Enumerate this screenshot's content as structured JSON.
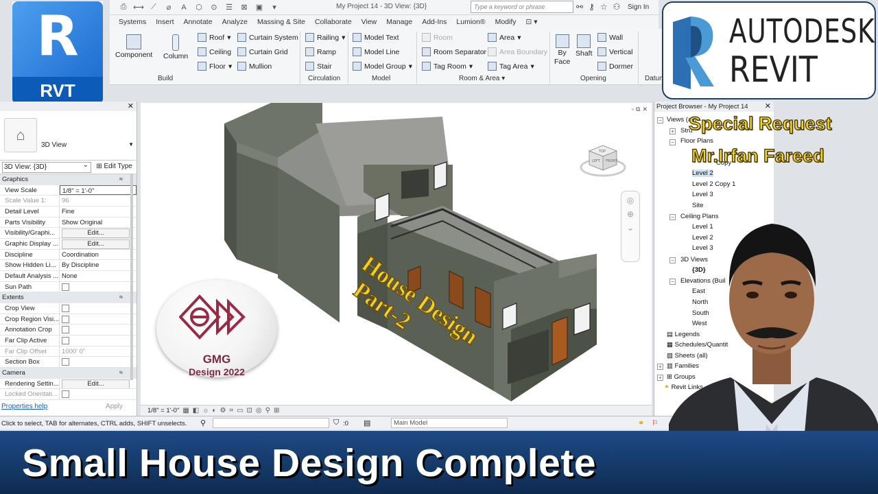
{
  "window": {
    "title": "My Project 14 - 3D View: {3D}",
    "search_placeholder": "Type a keyword or phrase",
    "sign_in": "Sign In"
  },
  "logos": {
    "rvt_letter": "R",
    "rvt_label": "RVT",
    "autodesk_line1": "AUTODESK",
    "autodesk_line2": "REVIT"
  },
  "tabs": [
    "Systems",
    "Insert",
    "Annotate",
    "Analyze",
    "Massing & Site",
    "Collaborate",
    "View",
    "Manage",
    "Add-Ins",
    "Lumion®",
    "Modify"
  ],
  "ribbon": {
    "build": {
      "component": "Component",
      "column": "Column",
      "roof": "Roof",
      "ceiling": "Ceiling",
      "floor": "Floor",
      "curtain_system": "Curtain System",
      "curtain_grid": "Curtain Grid",
      "mullion": "Mullion",
      "label": "Build"
    },
    "circulation": {
      "railing": "Railing",
      "ramp": "Ramp",
      "stair": "Stair",
      "label": "Circulation"
    },
    "model": {
      "model_text": "Model  Text",
      "model_line": "Model  Line",
      "model_group": "Model  Group",
      "label": "Model"
    },
    "room_area": {
      "room": "Room",
      "room_separator": "Room  Separator",
      "tag_room": "Tag  Room",
      "area": "Area",
      "area_boundary": "Area  Boundary",
      "tag_area": "Tag  Area",
      "label": "Room & Area"
    },
    "opening": {
      "by_face_1": "By",
      "by_face_2": "Face",
      "shaft": "Shaft",
      "wall": "Wall",
      "vertical": "Vertical",
      "dormer": "Dormer",
      "label": "Opening"
    },
    "datum": {
      "label": "Datum"
    }
  },
  "properties": {
    "type_name": "3D View",
    "view_selector": "3D View: {3D}",
    "edit_type": "Edit Type",
    "sections": {
      "graphics": "Graphics",
      "extents": "Extents",
      "camera": "Camera"
    },
    "graphics_rows": [
      {
        "k": "View Scale",
        "v": "1/8\" = 1'-0\""
      },
      {
        "k": "Scale Value   1:",
        "v": "96"
      },
      {
        "k": "Detail Level",
        "v": "Fine"
      },
      {
        "k": "Parts Visibility",
        "v": "Show Original"
      },
      {
        "k": "Visibility/Graphi...",
        "v": "Edit..."
      },
      {
        "k": "Graphic Display ...",
        "v": "Edit..."
      },
      {
        "k": "Discipline",
        "v": "Coordination"
      },
      {
        "k": "Show Hidden Li...",
        "v": "By Discipline"
      },
      {
        "k": "Default Analysis ...",
        "v": "None"
      },
      {
        "k": "Sun Path",
        "v": ""
      }
    ],
    "extents_rows": [
      {
        "k": "Crop View",
        "v": ""
      },
      {
        "k": "Crop Region Visi...",
        "v": ""
      },
      {
        "k": "Annotation Crop",
        "v": ""
      },
      {
        "k": "Far Clip Active",
        "v": ""
      },
      {
        "k": "Far Clip Offset",
        "v": "1000'  0\""
      },
      {
        "k": "Section Box",
        "v": ""
      }
    ],
    "camera_rows": [
      {
        "k": "Rendering Settin...",
        "v": "Edit..."
      },
      {
        "k": "Locked Orientati...",
        "v": ""
      }
    ],
    "help": "Properties help",
    "apply": "Apply"
  },
  "viewport": {
    "overlay_line1": "House Design",
    "overlay_line2": "Part-2",
    "scale": "1/8\" = 1'-0\"",
    "viewcube_top": "TOP",
    "viewcube_left": "LEFT",
    "viewcube_front": "FRONT"
  },
  "gmg": {
    "line1": "GMG",
    "line2": "Design 2022"
  },
  "project_browser": {
    "title": "Project Browser - My Project 14",
    "nodes": {
      "views": "Views (all)",
      "structural": "Stru",
      "floor_plans": "Floor Plans",
      "copy": "Copy",
      "level2": "Level 2",
      "level2copy": "Level 2 Copy 1",
      "level3": "Level 3",
      "site": "Site",
      "ceiling_plans": "Ceiling Plans",
      "c_level1": "Level 1",
      "c_level2": "Level 2",
      "c_level3": "Level 3",
      "views3d": "3D Views",
      "v3d": "{3D}",
      "elevations": "Elevations (Buil",
      "east": "East",
      "north": "North",
      "south": "South",
      "west": "West",
      "legends": "Legends",
      "schedules": "Schedules/Quantit",
      "sheets": "Sheets (all)",
      "families": "Families",
      "groups": "Groups",
      "revit_links": "Revit Links"
    }
  },
  "status": {
    "hint": "Click to select, TAB for alternates, CTRL adds, SHIFT unselects.",
    "zero": ":0",
    "model": "Main Model"
  },
  "overlay": {
    "special": "Special Request",
    "name": "Mr.Irfan Fareed",
    "banner": "Small House Design Complete"
  },
  "colors": {
    "banner": "#143866",
    "yellow_text": "#f5d81a",
    "rvt_blue": "#1e6fd0",
    "gmg_maroon": "#7a2842"
  }
}
